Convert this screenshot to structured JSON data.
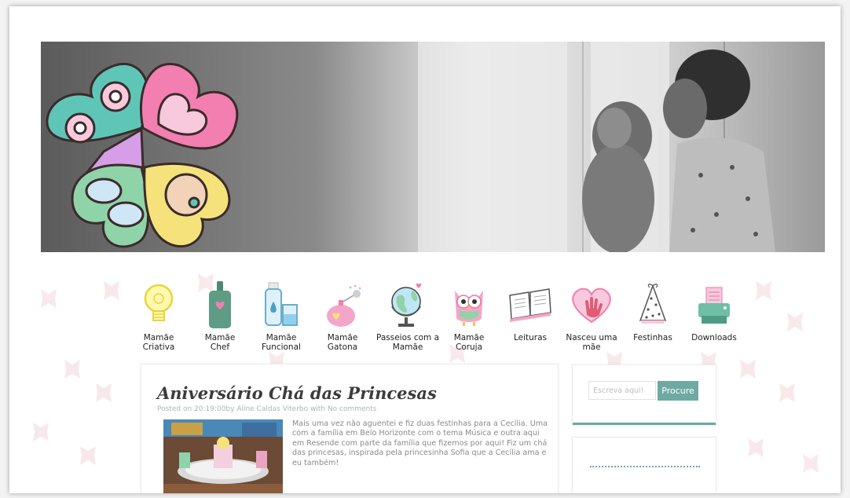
{
  "colors": {
    "accent": "#6ea9a2",
    "banner_bg": "#5b5b5b",
    "heart_pink": "#f27fb0",
    "heart_teal": "#5fc6b7",
    "heart_green": "#8fd3a9",
    "heart_yellow": "#f5e27a"
  },
  "nav": {
    "items": [
      {
        "label_line1": "Mamãe",
        "label_line2": "Criativa",
        "icon": "lightbulb-icon"
      },
      {
        "label_line1": "Mamãe",
        "label_line2": "Chef",
        "icon": "cutting-board-icon"
      },
      {
        "label_line1": "Mamãe",
        "label_line2": "Funcional",
        "icon": "bottle-glass-icon"
      },
      {
        "label_line1": "Mamãe",
        "label_line2": "Gatona",
        "icon": "perfume-icon"
      },
      {
        "label_line1": "Passeios com a",
        "label_line2": "Mamãe",
        "icon": "globe-icon"
      },
      {
        "label_line1": "Mamãe",
        "label_line2": "Coruja",
        "icon": "owl-icon"
      },
      {
        "label_line1": "Leituras",
        "label_line2": "",
        "icon": "book-icon"
      },
      {
        "label_line1": "Nasceu uma",
        "label_line2": "mãe",
        "icon": "heart-hand-icon"
      },
      {
        "label_line1": "Festinhas",
        "label_line2": "",
        "icon": "party-hat-icon"
      },
      {
        "label_line1": "Downloads",
        "label_line2": "",
        "icon": "printer-icon"
      }
    ]
  },
  "post": {
    "title": "Aniversário Chá das Princesas",
    "meta": "Posted on 20:19:00by Aline Caldas Viterbo with No comments",
    "excerpt": "Mais uma vez não aguentei e fiz duas festinhas para a Cecília. Uma com a família em Belo Horizonte com o tema Música e outra aqui em Resende com parte da família que fizemos por aqui! Fiz um chá das princesas, inspirada pela princesinha Sofia que a Cecília ama e eu também!"
  },
  "search": {
    "placeholder": "Escreva aqui!",
    "button_label": "Procure"
  }
}
